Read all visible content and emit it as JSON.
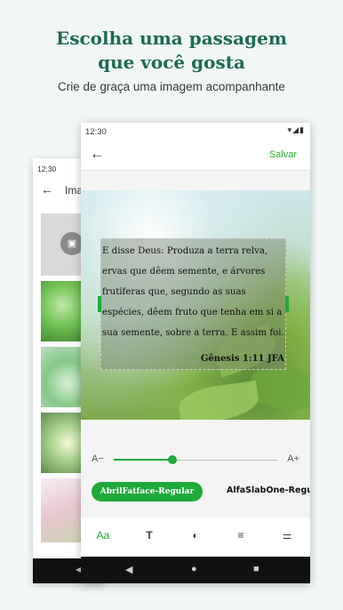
{
  "promo": {
    "headline_line1": "Escolha uma passagem",
    "headline_line2": "que você gosta",
    "subheadline": "Crie de graça uma imagem acompanhante"
  },
  "back_screen": {
    "status_time": "12:30",
    "title": "Ima",
    "back_icon": "arrow-left-icon",
    "placeholder_icon": "image-icon"
  },
  "editor": {
    "status_time": "12:30",
    "status_icons": [
      "wifi-icon",
      "signal-icon",
      "battery-icon"
    ],
    "back_icon": "arrow-left-icon",
    "save_label": "Salvar",
    "verse_text": "E disse Deus: Produza a terra relva, ervas que dêem semente, e árvores frutíferas que, segundo as suas espécies, dêem fruto que tenha em si a sua semente, sobre a terra. E assim foi.",
    "verse_reference": "Gênesis 1:11 JFA",
    "size_decrease_label": "A−",
    "size_increase_label": "A+",
    "font_size_level": 0.36,
    "fonts": {
      "selected": "AbrilFatface-Regular",
      "next": "AlfaSlabOne-Regular"
    },
    "toolbar": [
      {
        "icon": "font-icon",
        "label": "Aa",
        "active": true
      },
      {
        "icon": "text-icon",
        "label": "T",
        "active": false
      },
      {
        "icon": "contrast-icon",
        "label": "◐",
        "active": false
      },
      {
        "icon": "align-icon",
        "label": "≡",
        "active": false
      },
      {
        "icon": "sliders-icon",
        "label": "⚌",
        "active": false
      }
    ]
  },
  "colors": {
    "accent": "#1faa3a",
    "headline": "#1e6b50"
  }
}
